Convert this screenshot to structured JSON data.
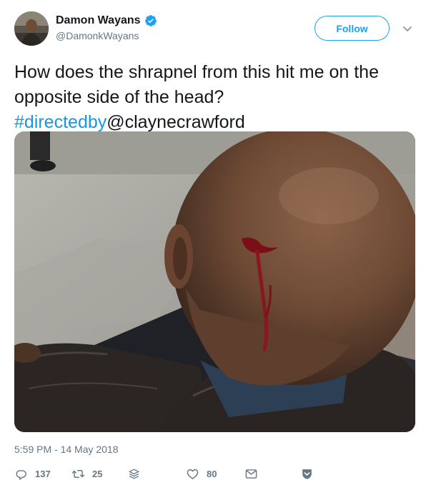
{
  "user": {
    "display_name": "Damon Wayans",
    "handle": "@DamonkWayans",
    "verified": true
  },
  "follow_button": {
    "label": "Follow"
  },
  "tweet": {
    "text_plain": "How does the shrapnel from this hit me on the opposite side of the head?",
    "hashtag": "#directedby",
    "mention": "@claynecrawford",
    "timestamp": "5:59 PM - 14 May 2018"
  },
  "actions": {
    "reply_count": "137",
    "retweet_count": "25",
    "like_count": "80"
  },
  "icons": {
    "verified": "verified-badge-icon",
    "caret": "chevron-down-icon",
    "reply": "reply-icon",
    "retweet": "retweet-icon",
    "stack": "layers-icon",
    "like": "heart-icon",
    "dm": "envelope-icon",
    "save": "bookmark-icon"
  },
  "colors": {
    "brand_blue": "#1da1f2",
    "link_blue": "#1b95e0",
    "muted_gray": "#657786",
    "text": "#14171a"
  }
}
